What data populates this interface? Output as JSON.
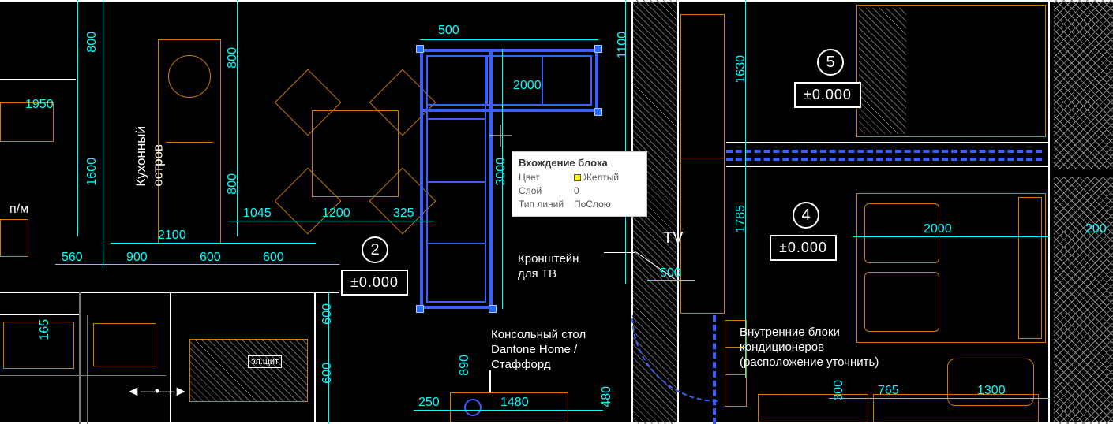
{
  "tooltip": {
    "title": "Вхождение блока",
    "rows": {
      "color_label": "Цвет",
      "color_value": "Желтый",
      "layer_label": "Слой",
      "layer_value": "0",
      "ltype_label": "Тип линий",
      "ltype_value": "ПоСлою"
    }
  },
  "rooms": {
    "r2": "2",
    "r4": "4",
    "r5": "5"
  },
  "levels": {
    "l2": "±0.000",
    "l4": "±0.000",
    "l5": "±0.000"
  },
  "labels": {
    "kitchen_island": "Кухонный\nостров",
    "wall_unit": "п/м",
    "elshield": "эл.щит",
    "tv": "TV",
    "tv_bracket": "Кронштейн\nдля ТВ",
    "console_table": "Консольный стол\nDantone Home /\nСтаффорд",
    "ac_blocks": "Внутренние блоки\nкондиционеров\n(расположение уточнить)"
  },
  "dims": {
    "d1950": "1950",
    "d1600": "1600",
    "d800a": "800",
    "d800b": "800",
    "d800c": "800",
    "d560": "560",
    "d900": "900",
    "d600a": "600",
    "d600b": "600",
    "d2100": "2100",
    "d1045": "1045",
    "d1200": "1200",
    "d325": "325",
    "d500top": "500",
    "d2000sofa": "2000",
    "d3000": "3000",
    "d1100": "1100",
    "d1630": "1630",
    "d1785": "1785",
    "d500tv": "500",
    "d2000room": "2000",
    "d200r": "200",
    "d765": "765",
    "d1300": "1300",
    "d890": "890",
    "d250": "250",
    "d1480": "1480",
    "d480": "480",
    "d300r": "300",
    "d165": "165",
    "d600c": "600",
    "d600d": "600"
  }
}
